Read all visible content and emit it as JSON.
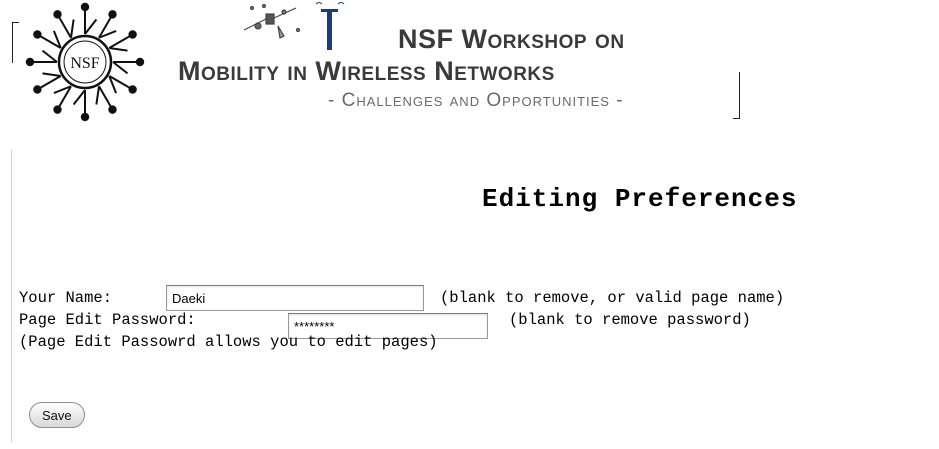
{
  "banner": {
    "logo_text": "NSF",
    "title_line1": "NSF Workshop on",
    "title_line2": "Mobility in Wireless Networks",
    "title_line3": "- Challenges and Opportunities -"
  },
  "page": {
    "title": "Editing Preferences"
  },
  "form": {
    "name_label": "Your Name:",
    "name_value": "Daeki",
    "name_hint": "(blank to remove, or valid page name)",
    "password_label": "Page Edit Password:",
    "password_value": "********",
    "password_hint": "(blank to remove password)",
    "note": "(Page Edit Passowrd allows you to edit pages)",
    "save_label": "Save"
  }
}
